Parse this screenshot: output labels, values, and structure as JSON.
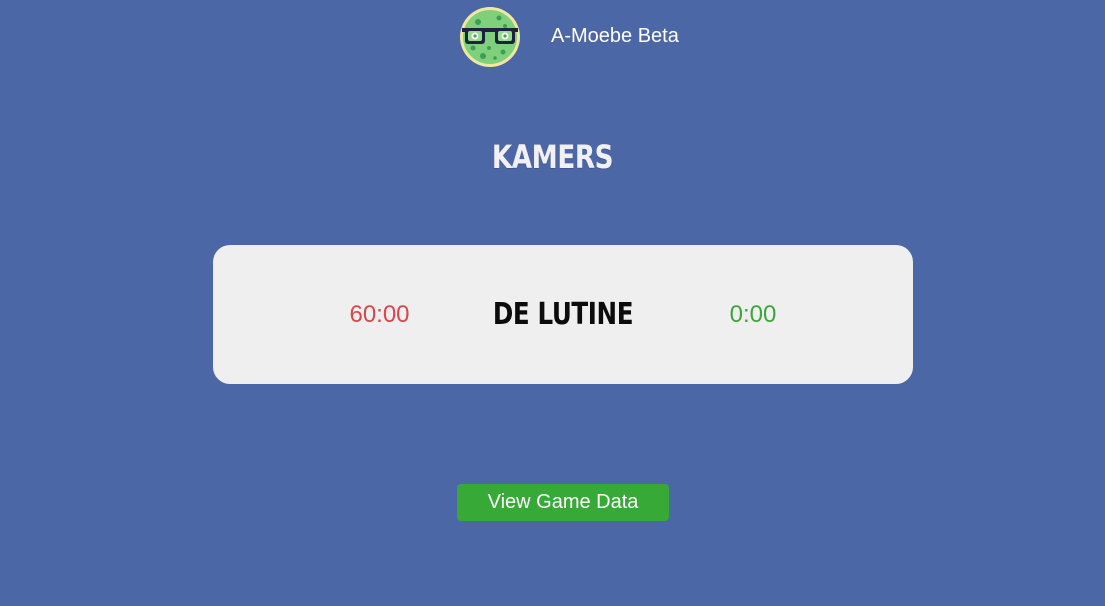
{
  "header": {
    "app_title": "A-Moebe Beta",
    "logo_icon": "amoeba-with-glasses-icon"
  },
  "page": {
    "title": "KAMERS"
  },
  "rooms": [
    {
      "name": "DE LUTINE",
      "time_remaining": "60:00",
      "time_elapsed": "0:00",
      "colors": {
        "remaining": "#d9474a",
        "elapsed": "#3da63a"
      }
    }
  ],
  "actions": {
    "view_game_data_label": "View Game Data"
  },
  "colors": {
    "background": "#4c67a6",
    "card": "#efefef",
    "button": "#36a936"
  }
}
